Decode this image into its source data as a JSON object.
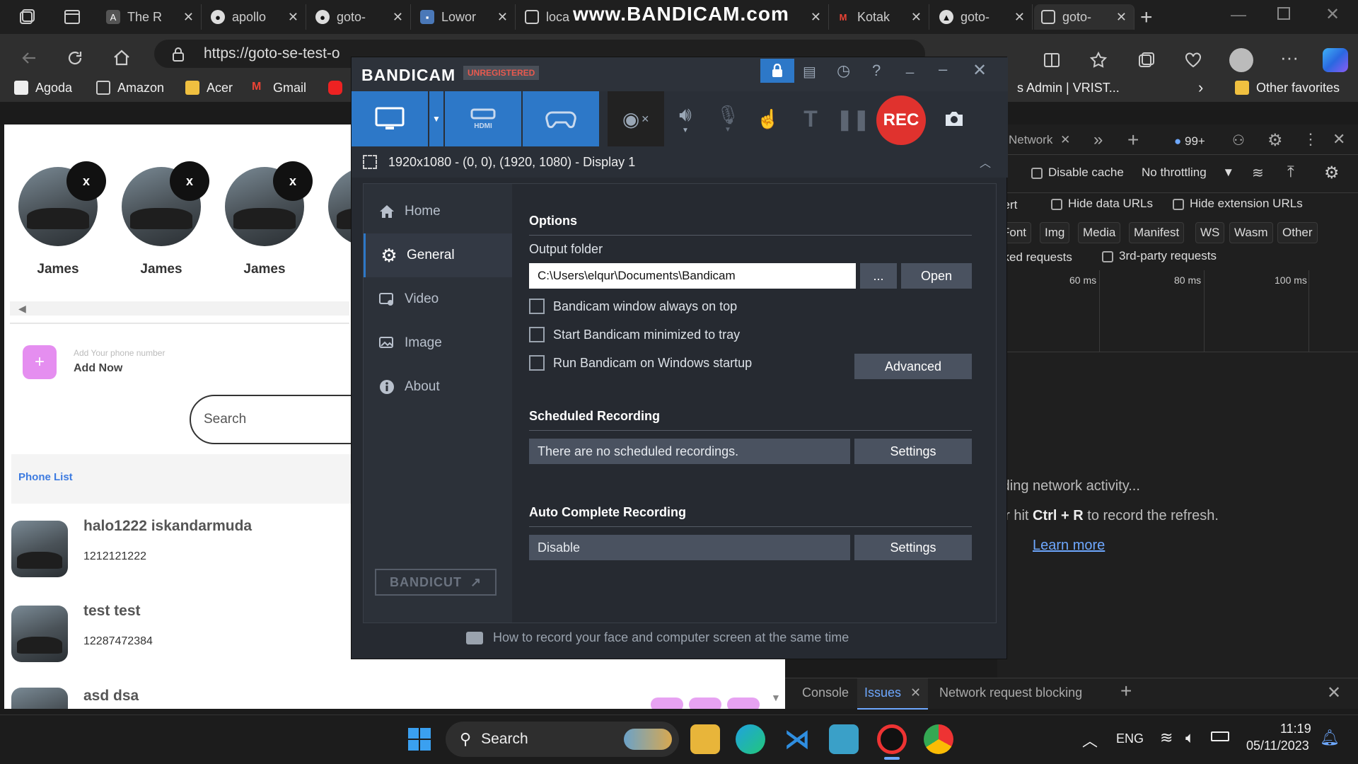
{
  "browser": {
    "tabs": [
      {
        "label": "The R",
        "icon": "copilot-icon"
      },
      {
        "label": "apollo",
        "icon": "github-icon"
      },
      {
        "label": "goto-",
        "icon": "github-icon"
      },
      {
        "label": "Lowor",
        "icon": "app-icon"
      },
      {
        "label": "loca",
        "icon": "page-icon"
      },
      {
        "label": "Kotak",
        "icon": "gmail-icon"
      },
      {
        "label": "goto-",
        "icon": "triangle-icon"
      },
      {
        "label": "goto-",
        "icon": "page-icon"
      }
    ],
    "watermark": "www.BANDICAM.com",
    "url": "https://goto-se-test-o",
    "bookmarks": [
      "Agoda",
      "Amazon",
      "Acer",
      "Gmail"
    ],
    "bookmark_right": "s Admin | VRIST...",
    "other_favorites": "Other favorites"
  },
  "webpage": {
    "avatars": [
      {
        "name": "James",
        "close": "x"
      },
      {
        "name": "James",
        "close": "x"
      },
      {
        "name": "James",
        "close": "x"
      }
    ],
    "add_phone_placeholder": "Add Your phone number",
    "add_now": "Add Now",
    "add_plus": "+",
    "search_placeholder": "Search",
    "phone_list_label": "Phone List",
    "contacts": [
      {
        "name": "halo1222 iskandarmuda",
        "phone": "1212121222"
      },
      {
        "name": "test test",
        "phone": "12287472384"
      },
      {
        "name": "asd dsa",
        "phone": ""
      }
    ]
  },
  "devtools": {
    "tab_network": "Network",
    "badge": "99+",
    "disable_cache": "Disable cache",
    "throttling": "No throttling",
    "invert_partial": "vert",
    "hide_data_urls": "Hide data URLs",
    "hide_extension_urls": "Hide extension URLs",
    "filters": [
      "Font",
      "Img",
      "Media",
      "Manifest",
      "WS",
      "Wasm",
      "Other"
    ],
    "blocked_partial": "cked requests",
    "third_party": "3rd-party requests",
    "timeline": [
      "60 ms",
      "80 ms",
      "100 ms"
    ],
    "g_partial": "g",
    "msg_line1": "rding network activity...",
    "msg_line2_pre": "or hit",
    "msg_line2_key": "Ctrl + R",
    "msg_line2_post": "to record the refresh.",
    "learn_more": "Learn more",
    "drawer_tabs": [
      "Console",
      "Issues",
      "Network request blocking"
    ]
  },
  "bandicam": {
    "title": "BANDICAM",
    "unregistered": "UNREGISTERED",
    "rec_label": "REC",
    "capture_area": "1920x1080 - (0, 0), (1920, 1080) - Display 1",
    "sidebar": [
      "Home",
      "General",
      "Video",
      "Image",
      "About"
    ],
    "bandicut": "BANDICUT",
    "options_header": "Options",
    "output_folder_label": "Output folder",
    "output_folder_value": "C:\\Users\\elqur\\Documents\\Bandicam",
    "browse_label": "...",
    "open_label": "Open",
    "checkboxes": [
      "Bandicam window always on top",
      "Start Bandicam minimized to tray",
      "Run Bandicam on Windows startup"
    ],
    "advanced_label": "Advanced",
    "scheduled_header": "Scheduled Recording",
    "scheduled_value": "There are no scheduled recordings.",
    "settings_label": "Settings",
    "auto_header": "Auto Complete Recording",
    "auto_value": "Disable",
    "footer_tip": "How to record your face and computer screen at the same time"
  },
  "taskbar": {
    "search_label": "Search",
    "lang": "ENG",
    "time": "11:19",
    "date": "05/11/2023"
  },
  "colors": {
    "bandicam_blue": "#2d78c8",
    "rec_red": "#e0322e",
    "page_accent": "#3d7be0",
    "devtools_link": "#6ea8ff"
  }
}
